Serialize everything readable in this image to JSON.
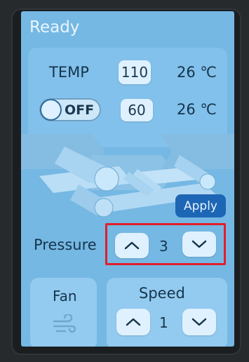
{
  "status": "Ready",
  "temperature": {
    "label": "TEMP",
    "row1": {
      "setpoint": "110",
      "reading": "26 ℃"
    },
    "toggle_label": "OFF",
    "row2": {
      "setpoint": "60",
      "reading": "26 ℃"
    }
  },
  "apply_label": "Apply",
  "pressure": {
    "label": "Pressure",
    "value": "3"
  },
  "fan": {
    "label": "Fan",
    "icon": "fan-wind-icon"
  },
  "speed": {
    "label": "Speed",
    "value": "1"
  },
  "colors": {
    "screen": "#75b8e3",
    "apply": "#1d66b5",
    "highlight": "#e21e2b"
  }
}
